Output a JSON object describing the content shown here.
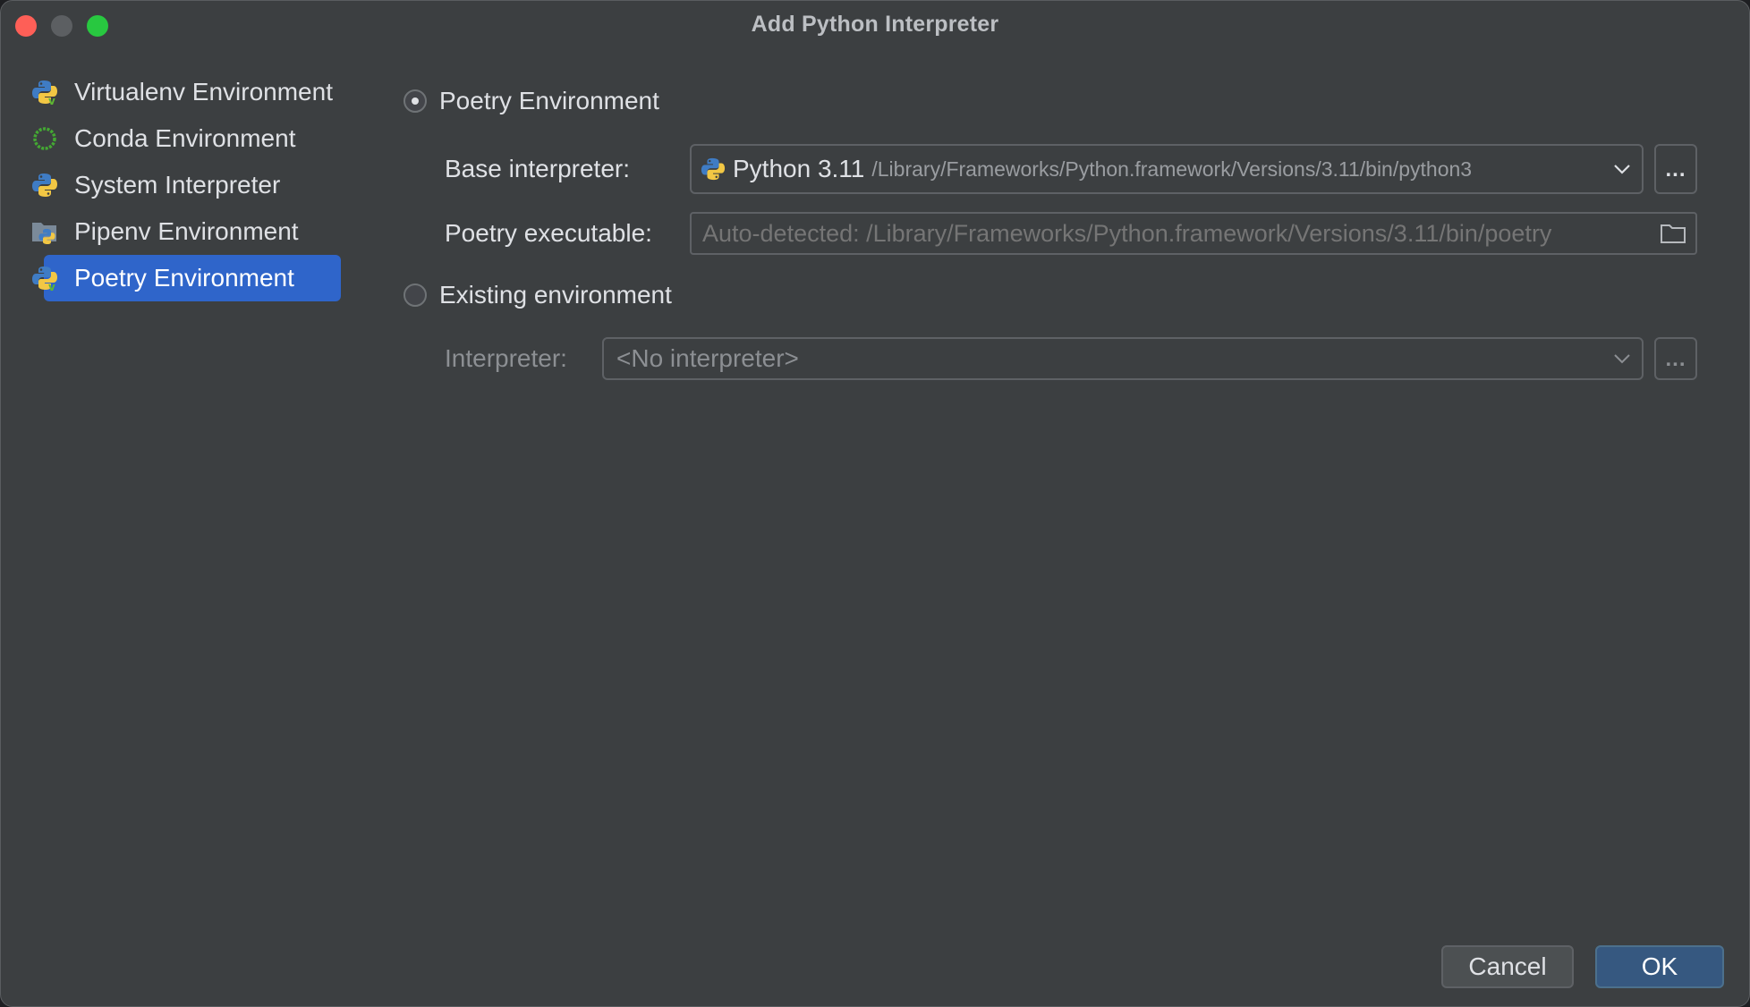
{
  "window": {
    "title": "Add Python Interpreter"
  },
  "sidebar": {
    "items": [
      {
        "label": "Virtualenv Environment",
        "icon": "python-venv-icon",
        "selected": false
      },
      {
        "label": "Conda Environment",
        "icon": "conda-icon",
        "selected": false
      },
      {
        "label": "System Interpreter",
        "icon": "python-icon",
        "selected": false
      },
      {
        "label": "Pipenv Environment",
        "icon": "pipenv-icon",
        "selected": false
      },
      {
        "label": "Poetry Environment",
        "icon": "python-poetry-icon",
        "selected": true
      }
    ]
  },
  "form": {
    "new_env_option": {
      "label": "Poetry Environment",
      "checked": true
    },
    "base_interpreter": {
      "label": "Base interpreter:",
      "version": "Python 3.11",
      "path": "/Library/Frameworks/Python.framework/Versions/3.11/bin/python3",
      "browse_label": "..."
    },
    "poetry_executable": {
      "label": "Poetry executable:",
      "value": "Auto-detected: /Library/Frameworks/Python.framework/Versions/3.11/bin/poetry"
    },
    "existing_env_option": {
      "label": "Existing environment",
      "checked": false
    },
    "interpreter": {
      "label": "Interpreter:",
      "value": "<No interpreter>",
      "browse_label": "..."
    }
  },
  "buttons": {
    "cancel": "Cancel",
    "ok": "OK"
  },
  "colors": {
    "background": "#3c3f41",
    "selection": "#2f65ca",
    "ok_button": "#365880",
    "text": "#dfe1e5",
    "disabled_text": "#8c8f93"
  }
}
